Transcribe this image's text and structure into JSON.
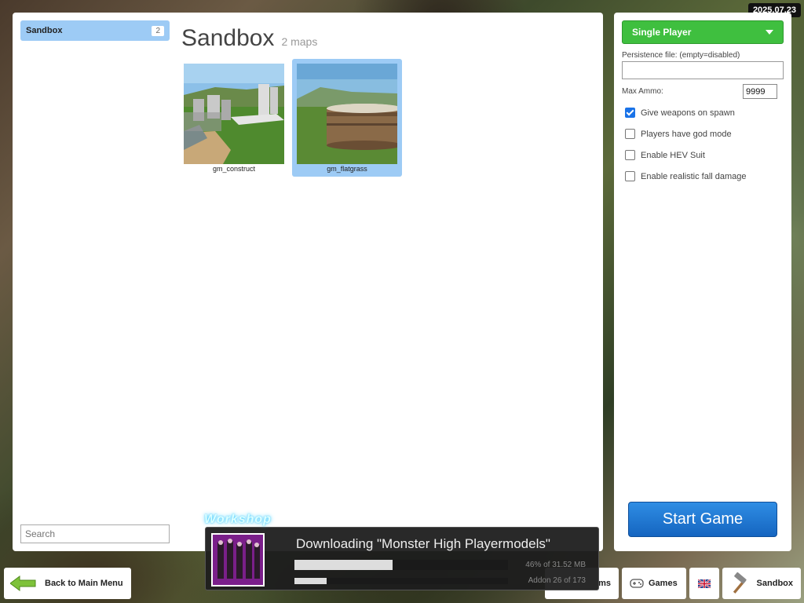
{
  "date_badge": "2025.07.23",
  "sidebar": {
    "categories": [
      {
        "label": "Sandbox",
        "count": "2"
      }
    ],
    "search_placeholder": "Search"
  },
  "main": {
    "title": "Sandbox",
    "subtitle": "2 maps",
    "maps": [
      {
        "name": "gm_construct",
        "selected": false
      },
      {
        "name": "gm_flatgrass",
        "selected": true
      }
    ]
  },
  "settings": {
    "mode": "Single Player",
    "persistence_label": "Persistence file: (empty=disabled)",
    "persistence_value": "",
    "max_ammo_label": "Max Ammo:",
    "max_ammo_value": "9999",
    "options": [
      {
        "label": "Give weapons on spawn",
        "checked": true
      },
      {
        "label": "Players have god mode",
        "checked": false
      },
      {
        "label": "Enable HEV Suit",
        "checked": false
      },
      {
        "label": "Enable realistic fall damage",
        "checked": false
      }
    ],
    "start_label": "Start Game"
  },
  "bottom_bar": {
    "back_label": "Back to Main Menu",
    "partial_tab_label": "ms",
    "games_label": "Games",
    "sandbox_label": "Sandbox"
  },
  "download": {
    "logo": "Workshop",
    "title": "Downloading \"Monster High Playermodels\"",
    "progress_fraction": 0.46,
    "progress_text": "46% of 31.52 MB",
    "addon_fraction": 0.15,
    "addon_text": "Addon 26 of 173"
  },
  "colors": {
    "accent_blue": "#9dcbf5",
    "mode_green": "#3fbf3f",
    "start_blue": "#1e6fd0"
  }
}
